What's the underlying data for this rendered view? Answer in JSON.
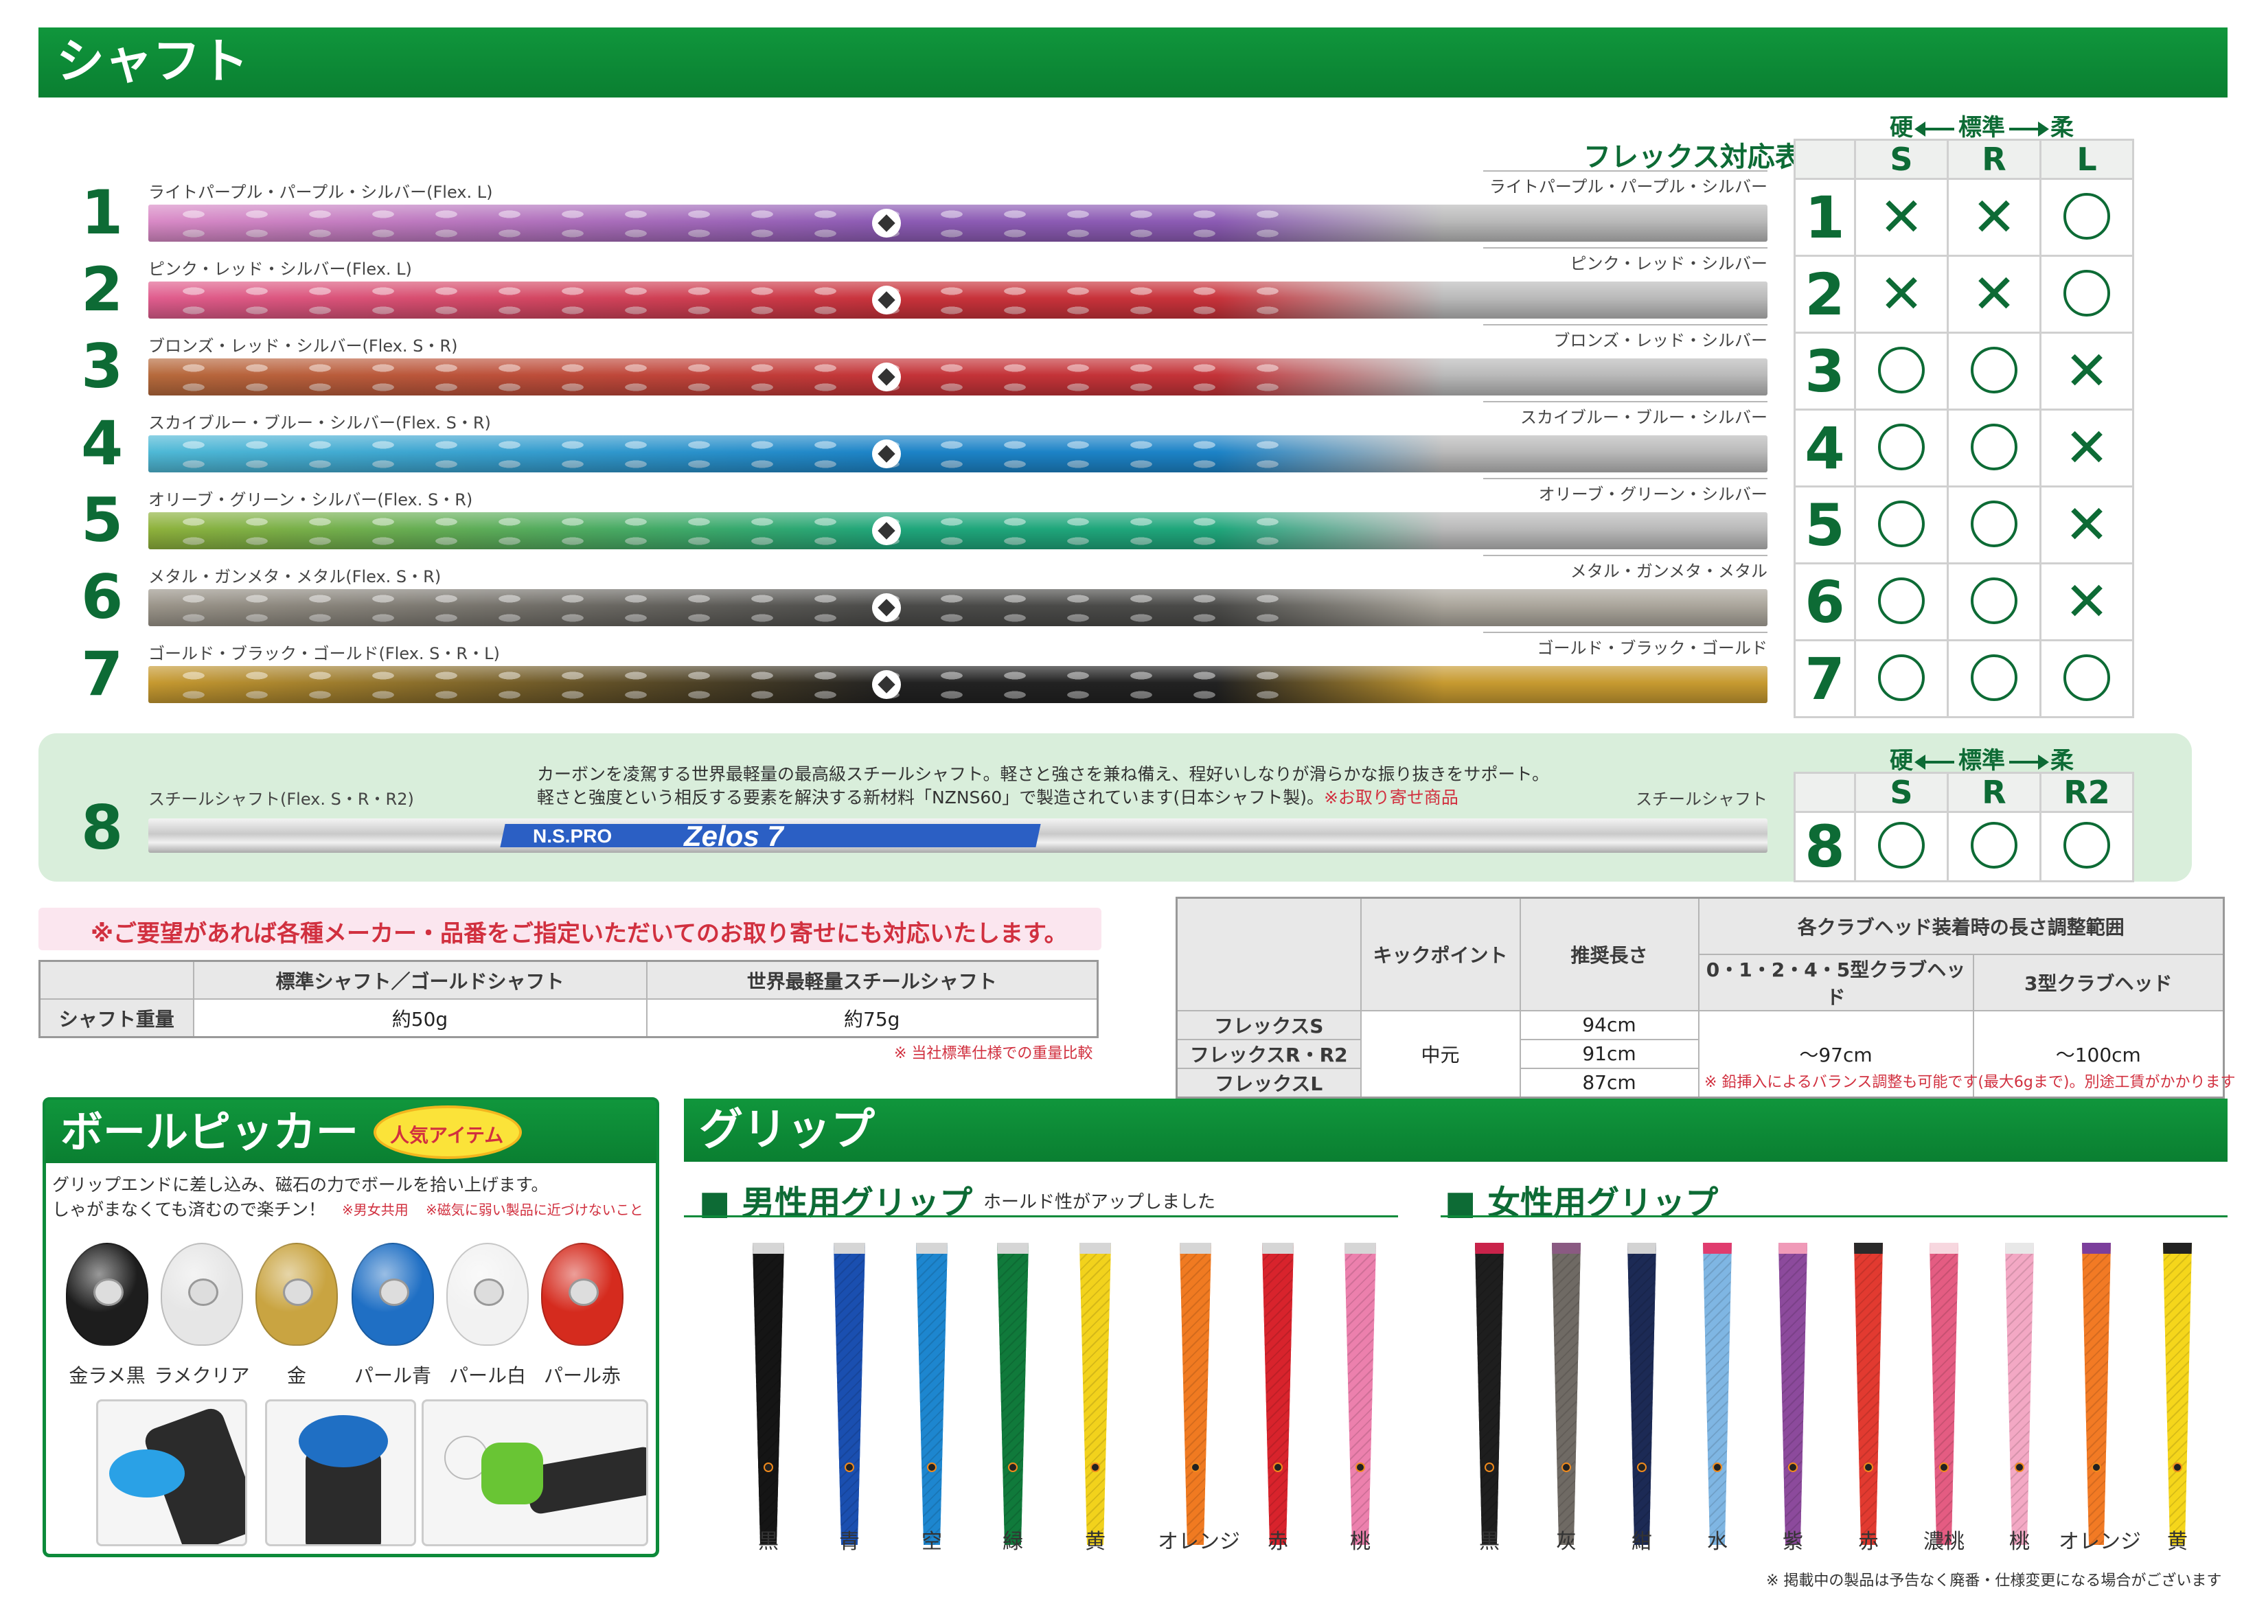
{
  "shaft_section": {
    "title": "シャフト"
  },
  "flex_table": {
    "title": "フレックス対応表",
    "arrow_hard": "硬",
    "arrow_std": "標準",
    "arrow_soft": "柔",
    "headers": [
      "S",
      "R",
      "L"
    ],
    "rows": [
      {
        "num": "1",
        "marks": [
          "x",
          "x",
          "o"
        ]
      },
      {
        "num": "2",
        "marks": [
          "x",
          "x",
          "o"
        ]
      },
      {
        "num": "3",
        "marks": [
          "o",
          "o",
          "x"
        ]
      },
      {
        "num": "4",
        "marks": [
          "o",
          "o",
          "x"
        ]
      },
      {
        "num": "5",
        "marks": [
          "o",
          "o",
          "x"
        ]
      },
      {
        "num": "6",
        "marks": [
          "o",
          "o",
          "x"
        ]
      },
      {
        "num": "7",
        "marks": [
          "o",
          "o",
          "o"
        ]
      }
    ]
  },
  "shafts": [
    {
      "num": "1",
      "name": "ライトパープル・パープル・シルバー(Flex. L)",
      "name_right": "ライトパープル・パープル・シルバー",
      "colors": [
        "#d98ac6",
        "#8c5bb4",
        "#b9b9b9"
      ]
    },
    {
      "num": "2",
      "name": "ピンク・レッド・シルバー(Flex. L)",
      "name_right": "ピンク・レッド・シルバー",
      "colors": [
        "#e05d8e",
        "#c8323a",
        "#b9b9b9"
      ]
    },
    {
      "num": "3",
      "name": "ブロンズ・レッド・シルバー(Flex. S・R)",
      "name_right": "ブロンズ・レッド・シルバー",
      "colors": [
        "#b66a3c",
        "#c43338",
        "#b9b9b9"
      ]
    },
    {
      "num": "4",
      "name": "スカイブルー・ブルー・シルバー(Flex. S・R)",
      "name_right": "スカイブルー・ブルー・シルバー",
      "colors": [
        "#4fb9d6",
        "#1c83c7",
        "#b9b9b9"
      ]
    },
    {
      "num": "5",
      "name": "オリーブ・グリーン・シルバー(Flex. S・R)",
      "name_right": "オリーブ・グリーン・シルバー",
      "colors": [
        "#8fb23c",
        "#1fa67b",
        "#b9b9b9"
      ]
    },
    {
      "num": "6",
      "name": "メタル・ガンメタ・メタル(Flex. S・R)",
      "name_right": "メタル・ガンメタ・メタル",
      "colors": [
        "#9b958a",
        "#4a4a48",
        "#aaa59b"
      ]
    },
    {
      "num": "7",
      "name": "ゴールド・ブラック・ゴールド(Flex. S・R・L)",
      "name_right": "ゴールド・ブラック・ゴールド",
      "colors": [
        "#c79a30",
        "#222222",
        "#c79a30"
      ]
    }
  ],
  "steel": {
    "num": "8",
    "name": "スチールシャフト(Flex. S・R・R2)",
    "name_right": "スチールシャフト",
    "desc1": "カーボンを凌駕する世界最軽量の最高級スチールシャフト。軽さと強さを兼ね備え、程好いしなりが滑らかな振り抜きをサポート。",
    "desc2": "軽さと強度という相反する要素を解決する新材料「NZNS60」で製造されています(日本シャフト製)。",
    "desc2_red": "※お取り寄せ商品",
    "brand": "N.S.PRO",
    "model": "Zelos 7",
    "headers": [
      "S",
      "R",
      "R2"
    ],
    "marks": [
      "o",
      "o",
      "o"
    ]
  },
  "order_note": "※ご要望があれば各種メーカー・品番をご指定いただいてのお取り寄せにも対応いたします。",
  "weight_table": {
    "col1": "標準シャフト／ゴールドシャフト",
    "col2": "世界最軽量スチールシャフト",
    "row_label": "シャフト重量",
    "v1": "約50g",
    "v2": "約75g",
    "note": "※ 当社標準仕様での重量比較"
  },
  "length_table": {
    "kick": "キックポイント",
    "recommended": "推奨長さ",
    "range_title": "各クラブヘッド装着時の長さ調整範囲",
    "head_a": "0・1・2・4・5型クラブヘッド",
    "head_b": "3型クラブヘッド",
    "rows": [
      {
        "label": "フレックスS",
        "len": "94cm"
      },
      {
        "label": "フレックスR・R2",
        "len": "91cm"
      },
      {
        "label": "フレックスL",
        "len": "87cm"
      }
    ],
    "kick_value": "中元",
    "range_a": "～97cm",
    "range_b": "～100cm",
    "note": "※ 鉛挿入によるバランス調整も可能です(最大6gまで)。別途工賃がかかります"
  },
  "picker": {
    "title": "ボールピッカー",
    "badge": "人気アイテム",
    "desc1": "グリップエンドに差し込み、磁石の力でボールを拾い上げます。",
    "desc2": "しゃがまなくても済むので楽チン！",
    "note1": "※男女共用",
    "note2": "※磁気に弱い製品に近づけないこと",
    "items": [
      {
        "label": "金ラメ黒",
        "color": "#1d1d1d"
      },
      {
        "label": "ラメクリア",
        "color": "#e6e6e6"
      },
      {
        "label": "金",
        "color": "#c9a441"
      },
      {
        "label": "パール青",
        "color": "#1f6fc4"
      },
      {
        "label": "パール白",
        "color": "#f2f2f2"
      },
      {
        "label": "パール赤",
        "color": "#d52b1e"
      }
    ]
  },
  "grip_section": {
    "title": "グリップ",
    "men_title": "■ 男性用グリップ",
    "men_sub": "ホールド性がアップしました",
    "women_title": "■ 女性用グリップ",
    "men": [
      {
        "label": "黒",
        "color": "#151515"
      },
      {
        "label": "青",
        "color": "#1a4fb0"
      },
      {
        "label": "空",
        "color": "#1d86cf"
      },
      {
        "label": "緑",
        "color": "#107a3b"
      },
      {
        "label": "黄",
        "color": "#f2d21c"
      },
      {
        "label": "オレンジ",
        "color": "#f07a21"
      },
      {
        "label": "赤",
        "color": "#d8232c"
      },
      {
        "label": "桃",
        "color": "#ec80ad"
      }
    ],
    "women": [
      {
        "label": "黒",
        "color": "#1e1e1e"
      },
      {
        "label": "灰",
        "color": "#6f6a64"
      },
      {
        "label": "紺",
        "color": "#1c2a55"
      },
      {
        "label": "水",
        "color": "#7fb6e3"
      },
      {
        "label": "紫",
        "color": "#8c4a9c"
      },
      {
        "label": "赤",
        "color": "#e23a30"
      },
      {
        "label": "濃桃",
        "color": "#e45c82"
      },
      {
        "label": "桃",
        "color": "#f3a8c4"
      },
      {
        "label": "オレンジ",
        "color": "#f27a24"
      },
      {
        "label": "黄",
        "color": "#f5d61b"
      }
    ],
    "footer_note": "※ 掲載中の製品は予告なく廃番・仕様変更になる場合がございます"
  }
}
